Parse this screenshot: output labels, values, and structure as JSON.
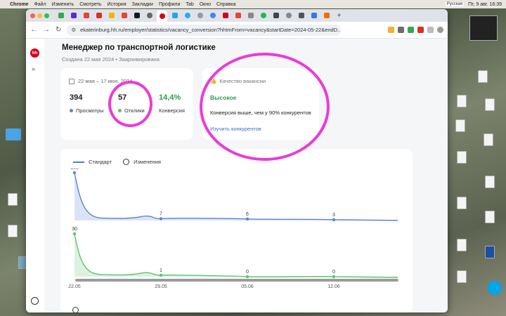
{
  "menubar": {
    "app": "Chrome",
    "items": [
      "Файл",
      "Изменить",
      "Смотреть",
      "История",
      "Закладки",
      "Профили",
      "Tab",
      "Окно",
      "Справка"
    ],
    "lang": "Русская",
    "clock": "Пт, 9 авг. 16:39"
  },
  "browser": {
    "url": "ekaterinburg.hh.ru/employer/statistics/vacancy_conversion?hhtmFrom=vacancy&startDate=2024-05-22&endD..."
  },
  "page": {
    "logo": "hh",
    "expand": "»",
    "title": "Менеджер по транспортной логистике",
    "created": "Создана 22 мая 2024",
    "status": "Заархивирована"
  },
  "stats": {
    "date_range": "22 мая – 17 июн. 2024",
    "views_value": "394",
    "views_label": "Просмотры",
    "responses_value": "57",
    "responses_label": "Отклики",
    "conversion_value": "14,4%",
    "conversion_label": "Конверсия"
  },
  "quality": {
    "heading": "Качество вакансии",
    "level": "Высокое",
    "text": "Конверсия выше, чем у 90% конкурентов",
    "link": "Изучить конкурентов"
  },
  "legend": {
    "standard": "Стандарт",
    "changes": "Изменения"
  },
  "colors": {
    "views": "#5b84d6",
    "responses": "#5ec26f",
    "conversion": "#2d9d4f",
    "annotation": "#ea3bd8"
  },
  "chart_data": {
    "type": "line",
    "x_labels": [
      "22.05",
      "29.05",
      "05.06",
      "12.06"
    ],
    "series": [
      {
        "values": [
          183,
          7,
          6,
          3
        ],
        "labels": [
          "183",
          "7",
          "6",
          "3"
        ]
      },
      {
        "values": [
          30,
          1,
          0,
          0
        ],
        "labels": [
          "30",
          "1",
          "0",
          "0"
        ]
      }
    ]
  }
}
